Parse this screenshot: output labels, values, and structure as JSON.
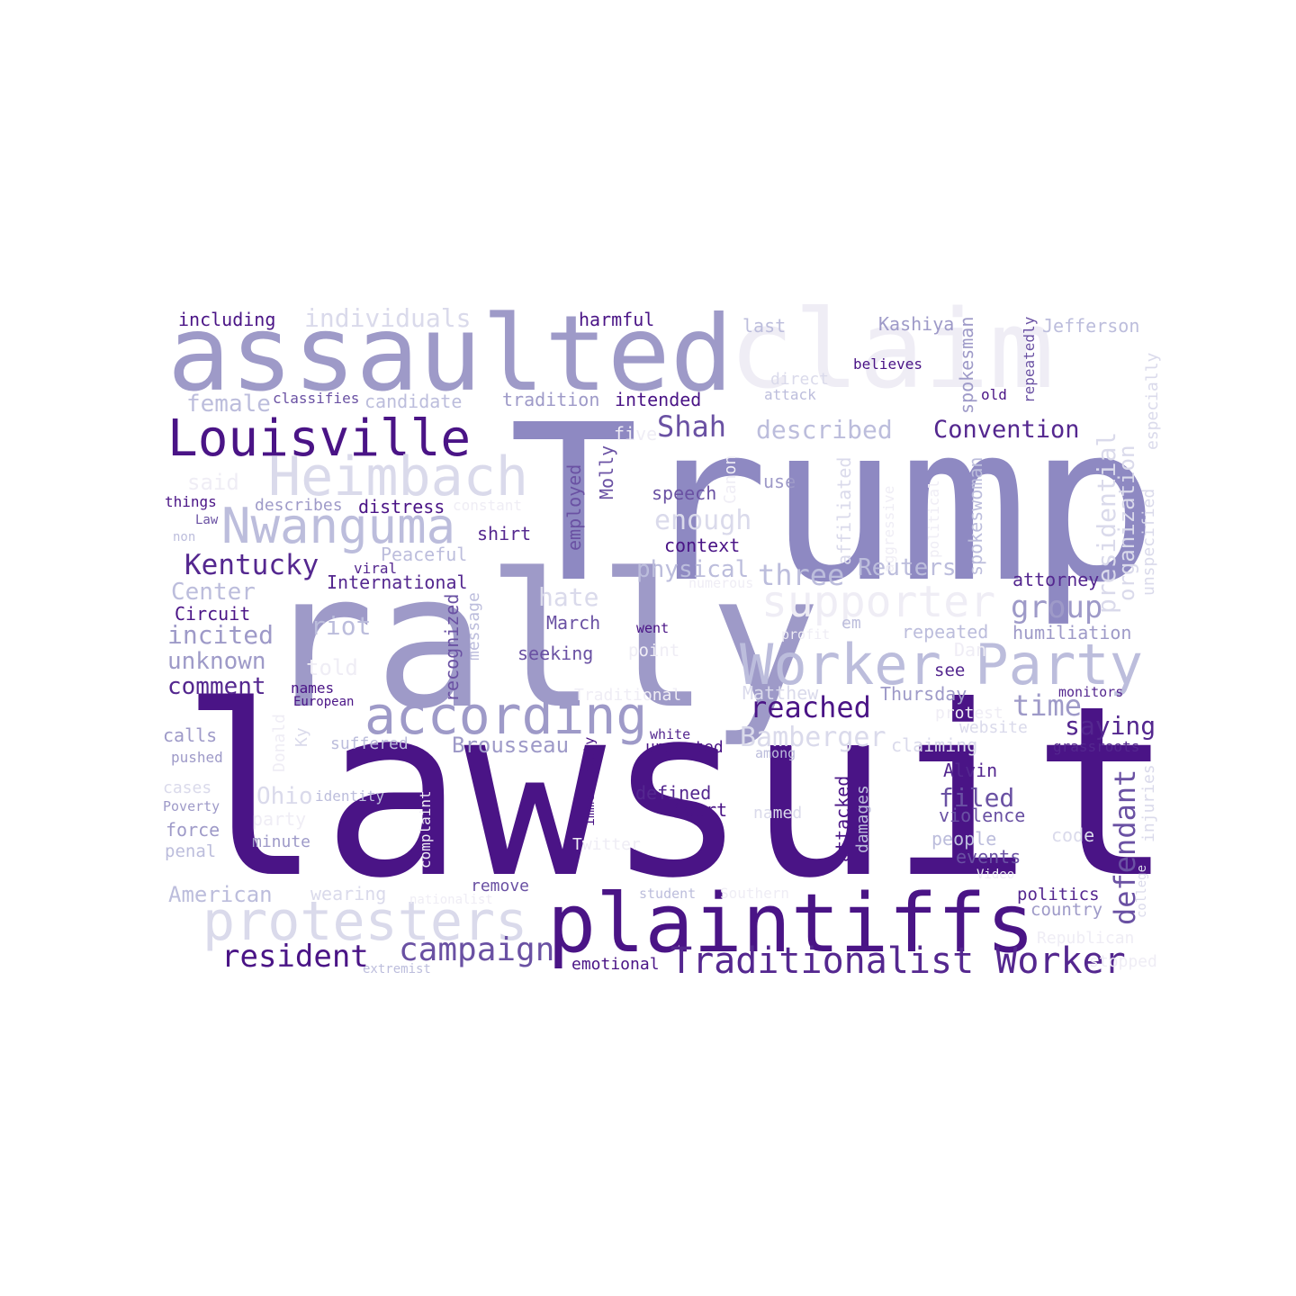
{
  "palette": {
    "deep": "#4a1486",
    "dark": "#54278f",
    "mid": "#6a51a3",
    "medium": "#8e89c2",
    "soft": "#9e9ac8",
    "light": "#bcbddc",
    "pale": "#dadaeb",
    "faint": "#efedf5"
  },
  "words": [
    {
      "text": "lawsuit",
      "color": "deep"
    },
    {
      "text": "Trump",
      "color": "medium"
    },
    {
      "text": "rally",
      "color": "soft"
    },
    {
      "text": "assaulted",
      "color": "soft"
    },
    {
      "text": "claim",
      "color": "faint"
    },
    {
      "text": "plaintiffs",
      "color": "deep"
    },
    {
      "text": "Worker Party",
      "color": "light"
    },
    {
      "text": "protesters",
      "color": "pale"
    },
    {
      "text": "Louisville",
      "color": "deep"
    },
    {
      "text": "according",
      "color": "soft"
    },
    {
      "text": "Heimbach",
      "color": "pale"
    },
    {
      "text": "Nwanguma",
      "color": "light"
    },
    {
      "text": "supporter",
      "color": "faint"
    },
    {
      "text": "Traditionalist Worker",
      "color": "dark"
    },
    {
      "text": "campaign",
      "color": "mid"
    },
    {
      "text": "resident",
      "color": "deep"
    },
    {
      "text": "Kentucky",
      "color": "dark"
    },
    {
      "text": "individuals",
      "color": "pale"
    },
    {
      "text": "reached",
      "color": "deep"
    },
    {
      "text": "defendant",
      "color": "mid"
    },
    {
      "text": "presidential",
      "color": "pale"
    },
    {
      "text": "group",
      "color": "soft"
    },
    {
      "text": "Convention",
      "color": "dark"
    },
    {
      "text": "described",
      "color": "light"
    },
    {
      "text": "Shah",
      "color": "mid"
    },
    {
      "text": "time",
      "color": "soft"
    },
    {
      "text": "Bamberger",
      "color": "pale"
    },
    {
      "text": "three",
      "color": "light"
    },
    {
      "text": "Reuters",
      "color": "light"
    },
    {
      "text": "physical",
      "color": "light"
    },
    {
      "text": "enough",
      "color": "pale"
    },
    {
      "text": "hate",
      "color": "pale"
    },
    {
      "text": "Brousseau",
      "color": "soft"
    },
    {
      "text": "saying",
      "color": "dark"
    },
    {
      "text": "Ohio",
      "color": "pale"
    },
    {
      "text": "American",
      "color": "light"
    },
    {
      "text": "comment",
      "color": "dark"
    },
    {
      "text": "unknown",
      "color": "soft"
    },
    {
      "text": "incited",
      "color": "soft"
    },
    {
      "text": "Center",
      "color": "light"
    },
    {
      "text": "riot",
      "color": "light"
    },
    {
      "text": "female",
      "color": "light"
    },
    {
      "text": "said",
      "color": "faint"
    },
    {
      "text": "told",
      "color": "faint"
    },
    {
      "text": "filed",
      "color": "mid"
    },
    {
      "text": "organization",
      "color": "pale"
    },
    {
      "text": "Thursday",
      "color": "soft"
    },
    {
      "text": "Matthew",
      "color": "pale"
    },
    {
      "text": "attorney",
      "color": "dark"
    },
    {
      "text": "humiliation",
      "color": "soft"
    },
    {
      "text": "repeated",
      "color": "light"
    },
    {
      "text": "Dan",
      "color": "faint"
    },
    {
      "text": "claiming",
      "color": "pale"
    },
    {
      "text": "violence",
      "color": "mid"
    },
    {
      "text": "Alvin",
      "color": "dark"
    },
    {
      "text": "people",
      "color": "light"
    },
    {
      "text": "events",
      "color": "mid"
    },
    {
      "text": "politics",
      "color": "dark"
    },
    {
      "text": "country",
      "color": "soft"
    },
    {
      "text": "Republican",
      "color": "faint"
    },
    {
      "text": "stopped",
      "color": "faint"
    },
    {
      "text": "code",
      "color": "pale"
    },
    {
      "text": "injuries",
      "color": "pale"
    },
    {
      "text": "college",
      "color": "pale"
    },
    {
      "text": "grassroots",
      "color": "dark"
    },
    {
      "text": "monitors",
      "color": "dark"
    },
    {
      "text": "website",
      "color": "pale"
    },
    {
      "text": "protest",
      "color": "faint"
    },
    {
      "text": "see",
      "color": "dark"
    },
    {
      "text": "point",
      "color": "faint"
    },
    {
      "text": "went",
      "color": "deep"
    },
    {
      "text": "em",
      "color": "light"
    },
    {
      "text": "profit",
      "color": "faint"
    },
    {
      "text": "numerous",
      "color": "faint"
    },
    {
      "text": "spokeswoman",
      "color": "light"
    },
    {
      "text": "spokesman",
      "color": "soft"
    },
    {
      "text": "political",
      "color": "faint"
    },
    {
      "text": "aggressive",
      "color": "faint"
    },
    {
      "text": "affiliated",
      "color": "pale"
    },
    {
      "text": "unspecified",
      "color": "pale"
    },
    {
      "text": "especially",
      "color": "pale"
    },
    {
      "text": "repeatedly",
      "color": "mid"
    },
    {
      "text": "Jefferson",
      "color": "light"
    },
    {
      "text": "Kashiya",
      "color": "soft"
    },
    {
      "text": "believes",
      "color": "deep"
    },
    {
      "text": "old",
      "color": "deep"
    },
    {
      "text": "last",
      "color": "light"
    },
    {
      "text": "direct",
      "color": "pale"
    },
    {
      "text": "attack",
      "color": "light"
    },
    {
      "text": "use",
      "color": "soft"
    },
    {
      "text": "Canon",
      "color": "faint"
    },
    {
      "text": "speech",
      "color": "mid"
    },
    {
      "text": "context",
      "color": "deep"
    },
    {
      "text": "Molly",
      "color": "mid"
    },
    {
      "text": "five",
      "color": "faint"
    },
    {
      "text": "employed",
      "color": "mid"
    },
    {
      "text": "intended",
      "color": "deep"
    },
    {
      "text": "harmful",
      "color": "deep"
    },
    {
      "text": "tradition",
      "color": "soft"
    },
    {
      "text": "candidate",
      "color": "light"
    },
    {
      "text": "classifies",
      "color": "mid"
    },
    {
      "text": "including",
      "color": "deep"
    },
    {
      "text": "distress",
      "color": "deep"
    },
    {
      "text": "describes",
      "color": "soft"
    },
    {
      "text": "constant",
      "color": "faint"
    },
    {
      "text": "shirt",
      "color": "dark"
    },
    {
      "text": "Peaceful",
      "color": "light"
    },
    {
      "text": "viral",
      "color": "dark"
    },
    {
      "text": "International",
      "color": "dark"
    },
    {
      "text": "things",
      "color": "deep"
    },
    {
      "text": "Law",
      "color": "mid"
    },
    {
      "text": "non",
      "color": "light"
    },
    {
      "text": "Circuit",
      "color": "deep"
    },
    {
      "text": "recognized",
      "color": "mid"
    },
    {
      "text": "message",
      "color": "light"
    },
    {
      "text": "March",
      "color": "mid"
    },
    {
      "text": "seeking",
      "color": "mid"
    },
    {
      "text": "names",
      "color": "deep"
    },
    {
      "text": "European",
      "color": "deep"
    },
    {
      "text": "calls",
      "color": "soft"
    },
    {
      "text": "pushed",
      "color": "soft"
    },
    {
      "text": "Donald",
      "color": "faint"
    },
    {
      "text": "Ky",
      "color": "pale"
    },
    {
      "text": "suffered",
      "color": "light"
    },
    {
      "text": "unwanted",
      "color": "deep"
    },
    {
      "text": "white",
      "color": "dark"
    },
    {
      "text": "immediately",
      "color": "deep"
    },
    {
      "text": "among",
      "color": "light"
    },
    {
      "text": "Traditional",
      "color": "faint"
    },
    {
      "text": "cases",
      "color": "pale"
    },
    {
      "text": "Poverty",
      "color": "soft"
    },
    {
      "text": "force",
      "color": "soft"
    },
    {
      "text": "penal",
      "color": "light"
    },
    {
      "text": "identity",
      "color": "light"
    },
    {
      "text": "party",
      "color": "faint"
    },
    {
      "text": "minute",
      "color": "soft"
    },
    {
      "text": "complaint",
      "color": "faint"
    },
    {
      "text": "defined",
      "color": "dark"
    },
    {
      "text": "Court",
      "color": "deep"
    },
    {
      "text": "named",
      "color": "pale"
    },
    {
      "text": "attacked",
      "color": "deep"
    },
    {
      "text": "damages",
      "color": "light"
    },
    {
      "text": "Twitter",
      "color": "faint"
    },
    {
      "text": "remove",
      "color": "mid"
    },
    {
      "text": "wearing",
      "color": "pale"
    },
    {
      "text": "nationalist",
      "color": "faint"
    },
    {
      "text": "student",
      "color": "light"
    },
    {
      "text": "Southern",
      "color": "faint"
    },
    {
      "text": "Video",
      "color": "faint"
    },
    {
      "text": "emotional",
      "color": "deep"
    },
    {
      "text": "extremist",
      "color": "light"
    }
  ]
}
